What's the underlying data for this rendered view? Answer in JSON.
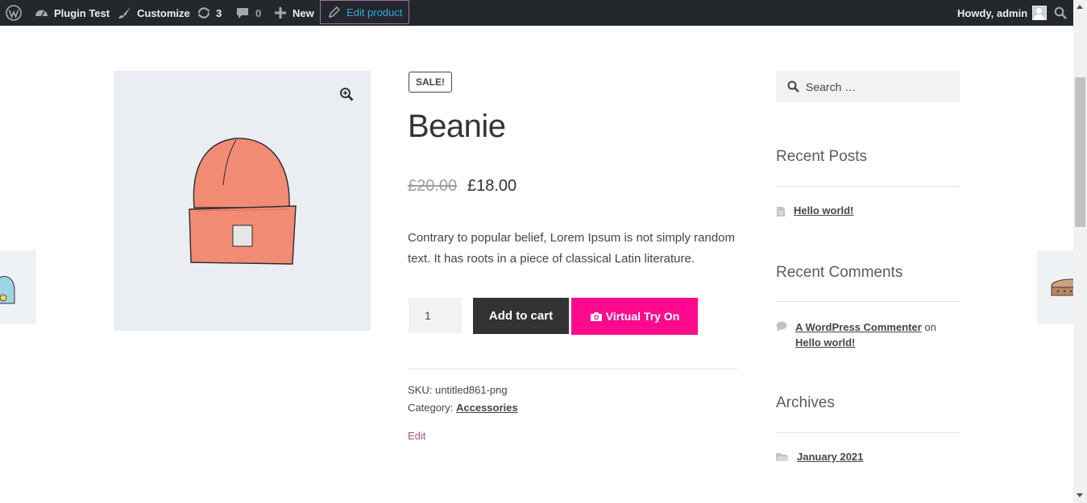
{
  "adminbar": {
    "site_name": "Plugin Test",
    "customize": "Customize",
    "updates_count": "3",
    "comments_count": "0",
    "new_label": "New",
    "edit_product": "Edit product",
    "howdy": "Howdy, admin"
  },
  "product": {
    "badge": "SALE!",
    "title": "Beanie",
    "price_old": "£20.00",
    "price_new": "£18.00",
    "description": "Contrary to popular belief, Lorem Ipsum is not simply random text. It has roots in a piece of classical Latin literature.",
    "quantity": "1",
    "add_to_cart": "Add to cart",
    "virtual_try_on": "Virtual Try On",
    "sku_label": "SKU:",
    "sku_value": "untitled861-png",
    "category_label": "Category:",
    "category_value": "Accessories",
    "edit_link": "Edit"
  },
  "sidebar": {
    "search_placeholder": "Search …",
    "recent_posts_title": "Recent Posts",
    "recent_post": "Hello world!",
    "recent_comments_title": "Recent Comments",
    "comment_author": "A WordPress Commenter",
    "comment_on": "on",
    "comment_post": "Hello world!",
    "archives_title": "Archives",
    "archive_item": "January 2021"
  },
  "colors": {
    "adminbar_bg": "#23282d",
    "tryon_button": "#ff0a8c",
    "cart_button": "#333333",
    "edit_link": "#96588a"
  }
}
